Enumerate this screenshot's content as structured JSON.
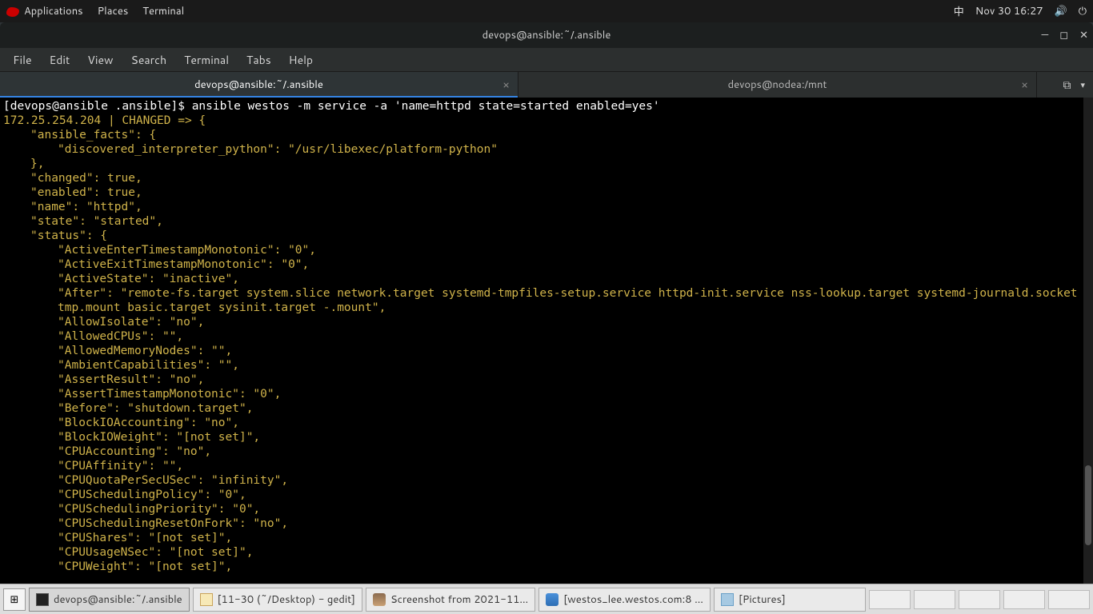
{
  "topbar": {
    "apps": "Applications",
    "places": "Places",
    "terminal": "Terminal",
    "input": "中",
    "datetime": "Nov 30  16:27"
  },
  "window": {
    "title": "devops@ansible:~/.ansible"
  },
  "menubar": {
    "file": "File",
    "edit": "Edit",
    "view": "View",
    "search": "Search",
    "terminal": "Terminal",
    "tabs": "Tabs",
    "help": "Help"
  },
  "tabs": {
    "t1": "devops@ansible:~/.ansible",
    "t2": "devops@nodea:/mnt"
  },
  "terminal": {
    "prompt": "[devops@ansible .ansible]$ ",
    "command": "ansible westos -m service -a 'name=httpd state=started enabled=yes'",
    "host_line": "172.25.254.204 | CHANGED => {",
    "lines": [
      {
        "indent": 1,
        "text": "\"ansible_facts\": {"
      },
      {
        "indent": 2,
        "text": "\"discovered_interpreter_python\": \"/usr/libexec/platform-python\""
      },
      {
        "indent": 1,
        "text": "},"
      },
      {
        "indent": 1,
        "text": "\"changed\": true,"
      },
      {
        "indent": 1,
        "text": "\"enabled\": true,"
      },
      {
        "indent": 1,
        "text": "\"name\": \"httpd\","
      },
      {
        "indent": 1,
        "text": "\"state\": \"started\","
      },
      {
        "indent": 1,
        "text": "\"status\": {"
      },
      {
        "indent": 2,
        "text": "\"ActiveEnterTimestampMonotonic\": \"0\","
      },
      {
        "indent": 2,
        "text": "\"ActiveExitTimestampMonotonic\": \"0\","
      },
      {
        "indent": 2,
        "text": "\"ActiveState\": \"inactive\","
      },
      {
        "indent": 2,
        "text": "\"After\": \"remote-fs.target system.slice network.target systemd-tmpfiles-setup.service httpd-init.service nss-lookup.target systemd-journald.socket tmp.mount basic.target sysinit.target -.mount\","
      },
      {
        "indent": 2,
        "text": "\"AllowIsolate\": \"no\","
      },
      {
        "indent": 2,
        "text": "\"AllowedCPUs\": \"\","
      },
      {
        "indent": 2,
        "text": "\"AllowedMemoryNodes\": \"\","
      },
      {
        "indent": 2,
        "text": "\"AmbientCapabilities\": \"\","
      },
      {
        "indent": 2,
        "text": "\"AssertResult\": \"no\","
      },
      {
        "indent": 2,
        "text": "\"AssertTimestampMonotonic\": \"0\","
      },
      {
        "indent": 2,
        "text": "\"Before\": \"shutdown.target\","
      },
      {
        "indent": 2,
        "text": "\"BlockIOAccounting\": \"no\","
      },
      {
        "indent": 2,
        "text": "\"BlockIOWeight\": \"[not set]\","
      },
      {
        "indent": 2,
        "text": "\"CPUAccounting\": \"no\","
      },
      {
        "indent": 2,
        "text": "\"CPUAffinity\": \"\","
      },
      {
        "indent": 2,
        "text": "\"CPUQuotaPerSecUSec\": \"infinity\","
      },
      {
        "indent": 2,
        "text": "\"CPUSchedulingPolicy\": \"0\","
      },
      {
        "indent": 2,
        "text": "\"CPUSchedulingPriority\": \"0\","
      },
      {
        "indent": 2,
        "text": "\"CPUSchedulingResetOnFork\": \"no\","
      },
      {
        "indent": 2,
        "text": "\"CPUShares\": \"[not set]\","
      },
      {
        "indent": 2,
        "text": "\"CPUUsageNSec\": \"[not set]\","
      },
      {
        "indent": 2,
        "text": "\"CPUWeight\": \"[not set]\","
      }
    ]
  },
  "taskbar": {
    "t1": "devops@ansible:~/.ansible",
    "t2": "[11-30 (~/Desktop) - gedit]",
    "t3": "Screenshot from 2021-11…",
    "t4": "[westos_lee.westos.com:8 …",
    "t5": "[Pictures]"
  }
}
